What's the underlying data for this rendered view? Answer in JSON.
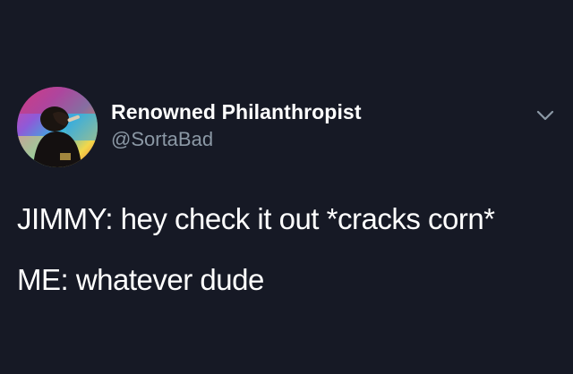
{
  "tweet": {
    "author": {
      "display_name": "Renowned Philanthropist",
      "handle": "@SortaBad",
      "avatar_icon": "user-avatar"
    },
    "menu_icon": "chevron-down-icon",
    "text_lines": [
      "JIMMY: hey check it out *cracks corn*",
      "ME: whatever dude"
    ]
  },
  "colors": {
    "background": "#161925",
    "text": "#ffffff",
    "handle": "#8b98a5",
    "chevron": "#8b98a5"
  }
}
